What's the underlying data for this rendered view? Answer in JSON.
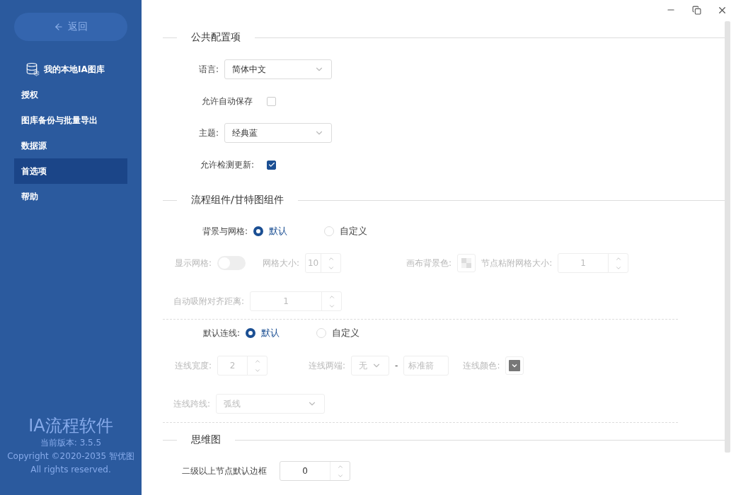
{
  "sidebar": {
    "back": "返回",
    "library": "我的本地IA图库",
    "items": [
      {
        "label": "授权",
        "selected": false
      },
      {
        "label": "图库备份与批量导出",
        "selected": false
      },
      {
        "label": "数据源",
        "selected": false
      },
      {
        "label": "首选项",
        "selected": true
      },
      {
        "label": "帮助",
        "selected": false
      }
    ],
    "app_name": "IA流程软件",
    "version": "当前版本: 3.5.5",
    "copyright": "Copyright ©2020-2035 智优图",
    "rights": "All rights reserved."
  },
  "public": {
    "title": "公共配置项",
    "language": {
      "label": "语言:",
      "value": "简体中文"
    },
    "autosave": {
      "label": "允许自动保存",
      "checked": false
    },
    "theme": {
      "label": "主题:",
      "value": "经典蓝"
    },
    "check_updates": {
      "label": "允许检测更新:",
      "checked": true
    }
  },
  "flow": {
    "title": "流程组件/甘特图组件",
    "background": {
      "label": "背景与网格:",
      "options": [
        {
          "label": "默认",
          "selected": true
        },
        {
          "label": "自定义",
          "selected": false
        }
      ]
    },
    "show_grid": {
      "label": "显示网格:",
      "on": false,
      "disabled": true
    },
    "grid_size": {
      "label": "网格大小:",
      "value": "10",
      "disabled": true
    },
    "canvas_color": {
      "label": "画布背景色:",
      "disabled": true
    },
    "snap_size": {
      "label": "节点粘附网格大小:",
      "value": "1",
      "disabled": true
    },
    "align_distance": {
      "label": "自动吸附对齐距离:",
      "value": "1",
      "disabled": true
    },
    "default_line": {
      "label": "默认连线:",
      "options": [
        {
          "label": "默认",
          "selected": true
        },
        {
          "label": "自定义",
          "selected": false
        }
      ]
    },
    "line_width": {
      "label": "连线宽度:",
      "value": "2",
      "disabled": true
    },
    "line_ends": {
      "label": "连线两端:",
      "start": "无",
      "separator": "-",
      "end": "标准箭",
      "disabled": true
    },
    "line_color": {
      "label": "连线颜色:",
      "disabled": true
    },
    "line_cross": {
      "label": "连线跨线:",
      "value": "弧线",
      "disabled": true
    }
  },
  "mindmap": {
    "title": "思维图",
    "border": {
      "label": "二级以上节点默认边框",
      "value": "0"
    }
  }
}
